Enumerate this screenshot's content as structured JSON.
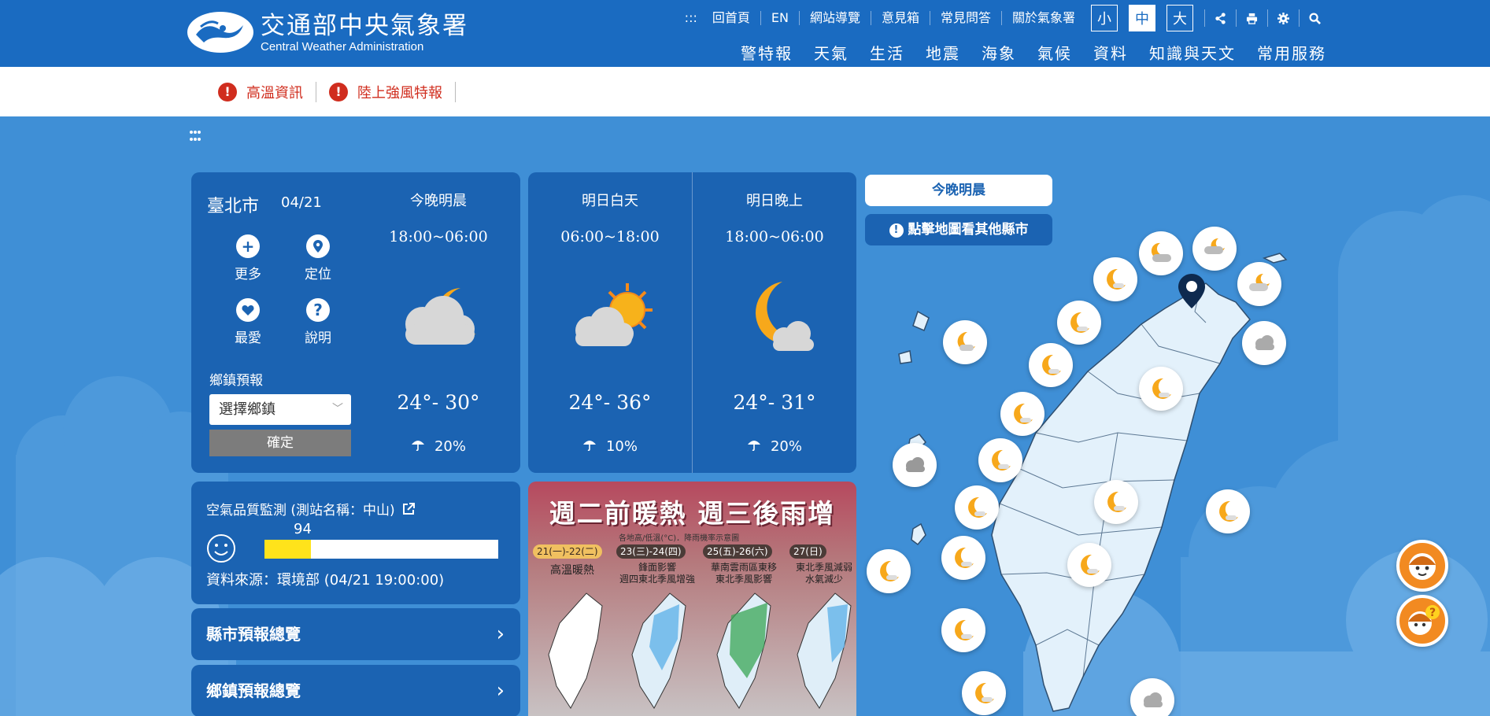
{
  "header": {
    "logo_zh": "交通部中央氣象署",
    "logo_en": "Central Weather Administration",
    "sitemap_mark": ":::",
    "top_links": [
      "回首頁",
      "EN",
      "網站導覽",
      "意見箱",
      "常見問答",
      "關於氣象署"
    ],
    "font_sizes": [
      "小",
      "中",
      "大"
    ],
    "font_size_selected": "中",
    "icons": [
      "share-icon",
      "print-icon",
      "gear-icon",
      "search-icon"
    ],
    "nav": [
      "警特報",
      "天氣",
      "生活",
      "地震",
      "海象",
      "氣候",
      "資料",
      "知識與天文",
      "常用服務"
    ]
  },
  "alerts": [
    {
      "label": "高溫資訊"
    },
    {
      "label": "陸上強風特報"
    }
  ],
  "forecast": {
    "city": "臺北市",
    "date": "04/21",
    "actions": [
      {
        "label": "更多",
        "icon": "plus-icon"
      },
      {
        "label": "定位",
        "icon": "location-icon"
      },
      {
        "label": "最愛",
        "icon": "heart-icon"
      },
      {
        "label": "說明",
        "icon": "question-icon"
      }
    ],
    "town_label": "鄉鎮預報",
    "town_select": "選擇鄉鎮",
    "town_confirm": "確定",
    "periods": [
      {
        "title": "今晚明晨",
        "time": "18:00~06:00",
        "temp": "24°- 30°",
        "rain": "20%",
        "icon": "cloud-moon"
      },
      {
        "title": "明日白天",
        "time": "06:00~18:00",
        "temp": "24°- 36°",
        "rain": "10%",
        "icon": "sun-cloud"
      },
      {
        "title": "明日晚上",
        "time": "18:00~06:00",
        "temp": "24°- 31°",
        "rain": "20%",
        "icon": "moon-cloud"
      }
    ]
  },
  "air_quality": {
    "title": "空氣品質監測 (測站名稱：中山)",
    "value": "94",
    "level_fraction": 0.2,
    "bar_color": "#ffe31b",
    "source": "資料來源：環境部 (04/21 19:00:00)"
  },
  "links": {
    "county": "縣市預報總覽",
    "town": "鄉鎮預報總覽"
  },
  "banner": {
    "title": "週二前暖熱 週三後雨增",
    "note": "各地高/低溫(°C)．降雨機率示意圖",
    "days": [
      {
        "label": "21(一)-22(二)",
        "desc": "高溫暖熱"
      },
      {
        "label": "23(三)-24(四)",
        "desc": "鋒面影響\n週四東北季風增強"
      },
      {
        "label": "25(五)-26(六)",
        "desc": "華南雲雨區東移\n東北季風影響"
      },
      {
        "label": "27(日)",
        "desc": "東北季風減弱\n水氣減少"
      }
    ]
  },
  "map": {
    "tab": "今晚明晨",
    "hint": "點擊地圖看其他縣市",
    "hint_icon": "!"
  },
  "colors": {
    "header_bg": "#1a6bc1",
    "card_bg": "#1b63b2",
    "page_bg": "#3f8fd6",
    "alert_red": "#d02d1e"
  }
}
